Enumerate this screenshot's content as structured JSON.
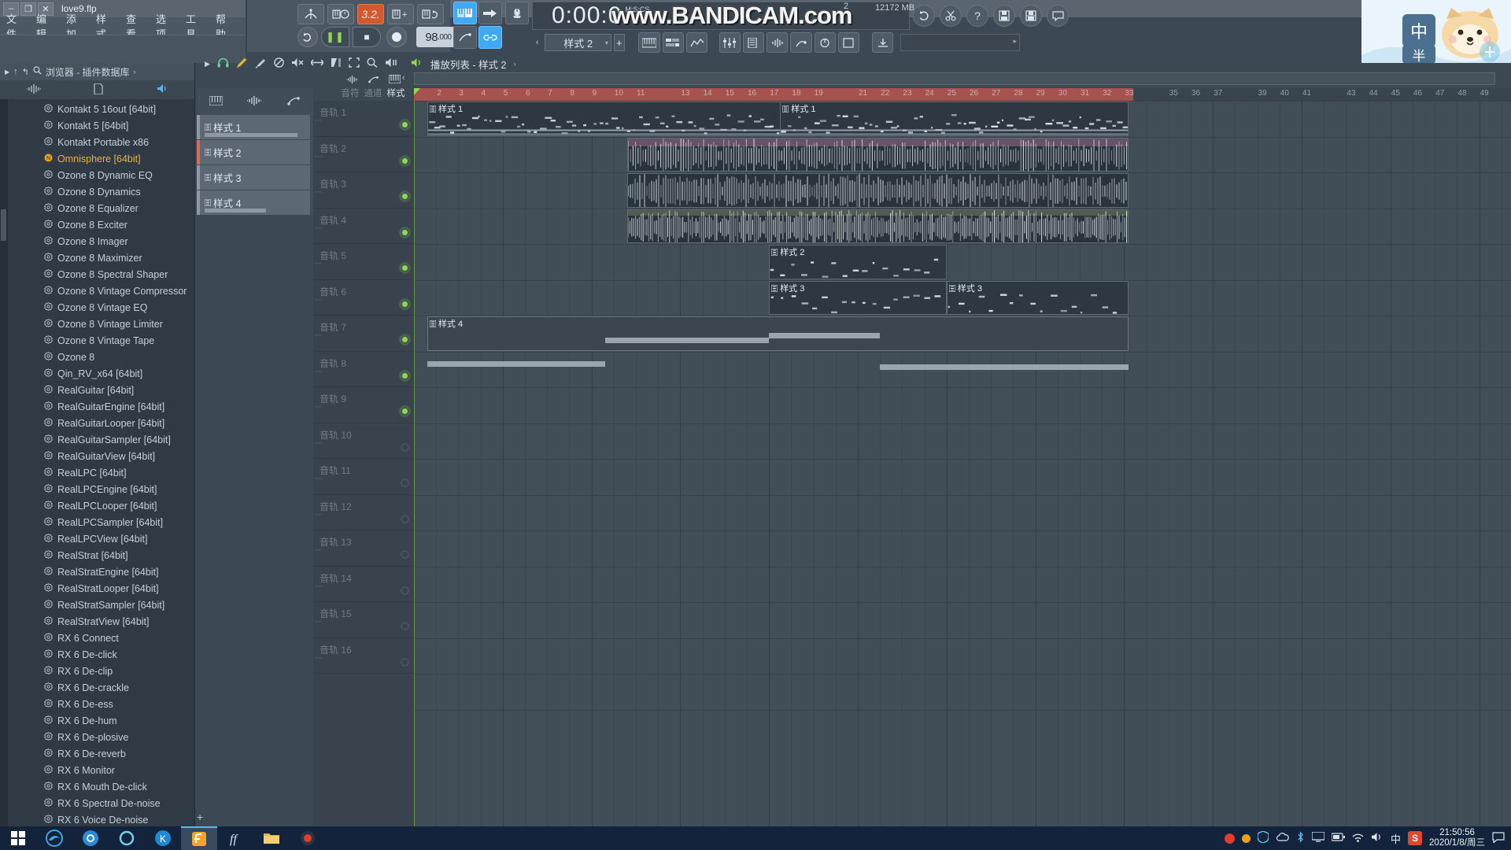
{
  "window": {
    "filename": "love9.flp",
    "minimize": "–",
    "maximize": "❐",
    "close": "✕"
  },
  "menu": [
    "文件",
    "编辑",
    "添加",
    "样式",
    "查看",
    "选项",
    "工具",
    "帮助"
  ],
  "transport": {
    "tempo": "98",
    "tempo_decimals": ".000",
    "pattern_mode": "3.2.",
    "buttons": {
      "metronome": "metronome-icon",
      "wait_midi": "wait-midi-icon",
      "step_add": "step-add-icon",
      "loop_record": "loop-record-icon",
      "pattern_song": "pattern-song-toggle",
      "play": "❚❚",
      "stop": "■",
      "record": "●"
    }
  },
  "time_display": {
    "value": "0:00:0",
    "format_label": "M:S:CS",
    "mem_count": "2",
    "mem_used": "12172 MB"
  },
  "watermark": "www.BANDICAM.com",
  "toolbar_right_icons": [
    "refresh-icon",
    "scissors-icon",
    "help-icon",
    "save-icon",
    "save-as-icon",
    "comment-icon"
  ],
  "second_row": {
    "pattern_selector": "样式 2",
    "add_button": "+",
    "tool_icons": [
      "piano-roll-icon",
      "playlist-icon",
      "event-editor-icon",
      "mixer-icon",
      "browser-icon",
      "wave-icon",
      "plugin-picker-icon",
      "step-seq-icon",
      "download-icon"
    ]
  },
  "ime": {
    "main": "中",
    "sub": "半"
  },
  "browser": {
    "header": "浏览器 - 插件数据库",
    "header_icons": [
      "play-arrow-icon",
      "up-arrow-icon",
      "back-icon",
      "search-icon",
      "chevron-right-icon"
    ],
    "tool_icons": [
      "wave-icon",
      "file-icon",
      "speaker-icon"
    ],
    "plugins": [
      {
        "name": "Kontakt 5 16out [64bit]",
        "highlight": false
      },
      {
        "name": "Kontakt 5 [64bit]",
        "highlight": false
      },
      {
        "name": "Kontakt Portable x86",
        "highlight": false
      },
      {
        "name": "Omnisphere [64bit]",
        "highlight": true
      },
      {
        "name": "Ozone 8 Dynamic EQ",
        "highlight": false
      },
      {
        "name": "Ozone 8 Dynamics",
        "highlight": false
      },
      {
        "name": "Ozone 8 Equalizer",
        "highlight": false
      },
      {
        "name": "Ozone 8 Exciter",
        "highlight": false
      },
      {
        "name": "Ozone 8 Imager",
        "highlight": false
      },
      {
        "name": "Ozone 8 Maximizer",
        "highlight": false
      },
      {
        "name": "Ozone 8 Spectral Shaper",
        "highlight": false
      },
      {
        "name": "Ozone 8 Vintage Compressor",
        "highlight": false
      },
      {
        "name": "Ozone 8 Vintage EQ",
        "highlight": false
      },
      {
        "name": "Ozone 8 Vintage Limiter",
        "highlight": false
      },
      {
        "name": "Ozone 8 Vintage Tape",
        "highlight": false
      },
      {
        "name": "Ozone 8",
        "highlight": false
      },
      {
        "name": "Qin_RV_x64 [64bit]",
        "highlight": false
      },
      {
        "name": "RealGuitar [64bit]",
        "highlight": false
      },
      {
        "name": "RealGuitarEngine [64bit]",
        "highlight": false
      },
      {
        "name": "RealGuitarLooper [64bit]",
        "highlight": false
      },
      {
        "name": "RealGuitarSampler [64bit]",
        "highlight": false
      },
      {
        "name": "RealGuitarView [64bit]",
        "highlight": false
      },
      {
        "name": "RealLPC [64bit]",
        "highlight": false
      },
      {
        "name": "RealLPCEngine [64bit]",
        "highlight": false
      },
      {
        "name": "RealLPCLooper [64bit]",
        "highlight": false
      },
      {
        "name": "RealLPCSampler [64bit]",
        "highlight": false
      },
      {
        "name": "RealLPCView [64bit]",
        "highlight": false
      },
      {
        "name": "RealStrat [64bit]",
        "highlight": false
      },
      {
        "name": "RealStratEngine [64bit]",
        "highlight": false
      },
      {
        "name": "RealStratLooper [64bit]",
        "highlight": false
      },
      {
        "name": "RealStratSampler [64bit]",
        "highlight": false
      },
      {
        "name": "RealStratView [64bit]",
        "highlight": false
      },
      {
        "name": "RX 6 Connect",
        "highlight": false
      },
      {
        "name": "RX 6 De-click",
        "highlight": false
      },
      {
        "name": "RX 6 De-clip",
        "highlight": false
      },
      {
        "name": "RX 6 De-crackle",
        "highlight": false
      },
      {
        "name": "RX 6 De-ess",
        "highlight": false
      },
      {
        "name": "RX 6 De-hum",
        "highlight": false
      },
      {
        "name": "RX 6 De-plosive",
        "highlight": false
      },
      {
        "name": "RX 6 De-reverb",
        "highlight": false
      },
      {
        "name": "RX 6 Monitor",
        "highlight": false
      },
      {
        "name": "RX 6 Mouth De-click",
        "highlight": false
      },
      {
        "name": "RX 6 Spectral De-noise",
        "highlight": false
      },
      {
        "name": "RX 6 Voice De-noise",
        "highlight": false
      }
    ]
  },
  "pattern_picker": {
    "tool_icons": [
      "step-seq-icon",
      "wave-icon",
      "automation-icon"
    ],
    "patterns": [
      "样式 1",
      "样式 2",
      "样式 3",
      "样式 4"
    ],
    "selected": "样式 2",
    "add_label": "+"
  },
  "playlist": {
    "title": "播放列表 - 样式 2",
    "toolbar_icons": [
      "arrow-icon",
      "magnet-icon",
      "pencil-icon",
      "paint-icon",
      "delete-icon",
      "mute-icon",
      "slice-icon",
      "select-icon",
      "zoom-icon",
      "playback-icon"
    ],
    "tabs": [
      {
        "label": "音符",
        "active": false,
        "icon": "wave-icon"
      },
      {
        "label": "通道",
        "active": false,
        "icon": "automation-icon"
      },
      {
        "label": "样式",
        "active": true,
        "icon": "step-seq-icon"
      }
    ],
    "nav_chevron": "‹",
    "ruler_marks": [
      "2",
      "3",
      "4",
      "5",
      "6",
      "7",
      "8",
      "9",
      "10",
      "11",
      "13",
      "14",
      "15",
      "16",
      "17",
      "18",
      "19",
      "21",
      "22",
      "23",
      "24",
      "25",
      "26",
      "27",
      "28",
      "29",
      "30",
      "31",
      "32",
      "33",
      "35",
      "36",
      "37",
      "39",
      "40",
      "41",
      "43",
      "44",
      "45",
      "46",
      "47",
      "48",
      "49"
    ],
    "tracks": [
      {
        "name": "音轨 1",
        "led": "on"
      },
      {
        "name": "音轨 2",
        "led": "on"
      },
      {
        "name": "音轨 3",
        "led": "on"
      },
      {
        "name": "音轨 4",
        "led": "on"
      },
      {
        "name": "音轨 5",
        "led": "on"
      },
      {
        "name": "音轨 6",
        "led": "on"
      },
      {
        "name": "音轨 7",
        "led": "on"
      },
      {
        "name": "音轨 8",
        "led": "on"
      },
      {
        "name": "音轨 9",
        "led": "on"
      },
      {
        "name": "音轨 10",
        "led": "off"
      },
      {
        "name": "音轨 11",
        "led": "off"
      },
      {
        "name": "音轨 12",
        "led": "off"
      },
      {
        "name": "音轨 13",
        "led": "off"
      },
      {
        "name": "音轨 14",
        "led": "off"
      },
      {
        "name": "音轨 15",
        "led": "off"
      },
      {
        "name": "音轨 16",
        "led": "off"
      }
    ],
    "clips": [
      {
        "label": "样式 1",
        "track": 1,
        "start_bar": 1.6,
        "end_bar": 33.2,
        "type": "notes"
      },
      {
        "label": "样式 1",
        "track": 1,
        "start_bar": 17.5,
        "end_bar": 33.2,
        "type": "notes",
        "label_only": true
      },
      {
        "label": "",
        "track": 2,
        "start_bar": 10.6,
        "end_bar": 33.2,
        "type": "audio"
      },
      {
        "label": "",
        "track": 3,
        "start_bar": 10.6,
        "end_bar": 33.2,
        "type": "audio"
      },
      {
        "label": "",
        "track": 4,
        "start_bar": 10.6,
        "end_bar": 33.2,
        "type": "audio"
      },
      {
        "label": "样式 2",
        "track": 5,
        "start_bar": 17.0,
        "end_bar": 25.0,
        "type": "notes"
      },
      {
        "label": "样式 3",
        "track": 6,
        "start_bar": 17.0,
        "end_bar": 25.0,
        "type": "notes"
      },
      {
        "label": "样式 3",
        "track": 6,
        "start_bar": 25.0,
        "end_bar": 33.2,
        "type": "notes"
      },
      {
        "label": "样式 4",
        "track": 7,
        "start_bar": 1.6,
        "end_bar": 33.2,
        "type": "automation"
      }
    ]
  },
  "taskbar": {
    "start": "start-icon",
    "pinned": [
      "edge-icon",
      "chrome-icon",
      "cortana-icon",
      "kugou-icon",
      "fl-studio-icon",
      "font-icon",
      "explorer-icon",
      "recorder-icon"
    ],
    "tray": [
      "record-icon",
      "orange-dot-icon",
      "shield-icon",
      "onedrive-icon",
      "bluetooth-icon",
      "display-icon",
      "battery-icon",
      "network-icon",
      "volume-icon"
    ],
    "ime_label": "中",
    "sogou_label": "S",
    "clock_time": "21:50:56",
    "clock_date": "2020/1/8/周三",
    "notification": "notification-icon"
  },
  "colors": {
    "accent_blue": "#3fa9f5",
    "record_orange": "#d4582e",
    "led_green": "#8fd94b",
    "ruler_red": "#a7524e",
    "highlight_yellow": "#e8b33a"
  }
}
